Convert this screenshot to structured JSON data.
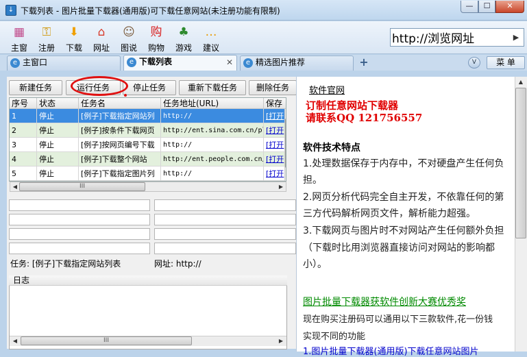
{
  "window": {
    "title": "下载列表 - 图片批量下载器(通用版)可下载任意网站(未注册功能有限制)",
    "min_glyph": "—",
    "max_glyph": "☐",
    "close_glyph": "✕"
  },
  "toolbar": {
    "items": [
      {
        "label": "主窗",
        "icon": "home-grid-icon",
        "glyph": "▦",
        "color": "#c04a8a"
      },
      {
        "label": "注册",
        "icon": "key-icon",
        "glyph": "⚿",
        "color": "#d2a023"
      },
      {
        "label": "下载",
        "icon": "download-arrow-icon",
        "glyph": "⬇",
        "color": "#f0a000"
      },
      {
        "label": "网址",
        "icon": "house-icon",
        "glyph": "⌂",
        "color": "#d83a2a"
      },
      {
        "label": "图说",
        "icon": "portrait-icon",
        "glyph": "☺",
        "color": "#7a5a3a"
      },
      {
        "label": "购物",
        "icon": "shopping-icon",
        "glyph": "购",
        "color": "#d81e1e"
      },
      {
        "label": "游戏",
        "icon": "game-icon",
        "glyph": "♣",
        "color": "#2e8a2e"
      },
      {
        "label": "建议",
        "icon": "chat-bubble-icon",
        "glyph": "…",
        "color": "#e89a00"
      }
    ]
  },
  "address": {
    "value": "http://浏览网址",
    "go_glyph": "▶"
  },
  "tabs": [
    {
      "label": "主窗口",
      "active": false
    },
    {
      "label": "下载列表",
      "active": true
    },
    {
      "label": "精选图片推荐",
      "active": false
    }
  ],
  "tab_add_glyph": "+",
  "tab_menu_glyph": "V",
  "menu_label": "菜 单",
  "actions": {
    "new": "新建任务",
    "run": "运行任务",
    "stop": "停止任务",
    "redownload": "重新下载任务",
    "delete": "删除任务"
  },
  "table": {
    "headers": [
      "序号",
      "状态",
      "任务名",
      "任务地址(URL)",
      "保存"
    ],
    "rows": [
      {
        "no": "1",
        "status": "停止",
        "name": "[例子]下载指定网站列",
        "url": "http://",
        "save": "[打开"
      },
      {
        "no": "2",
        "status": "停止",
        "name": "[例子]按条件下载网页",
        "url": "http://ent.sina.com.cn/pl",
        "save": "[打开"
      },
      {
        "no": "3",
        "status": "停止",
        "name": "[例子]按网页编号下载",
        "url": "http://",
        "save": "[打开"
      },
      {
        "no": "4",
        "status": "停止",
        "name": "[例子]下载整个网站",
        "url": "http://ent.people.com.cn/",
        "save": "[打开"
      },
      {
        "no": "5",
        "status": "停止",
        "name": "[例子]下载指定图片列",
        "url": "http://",
        "save": "[打开"
      }
    ]
  },
  "scroll": {
    "left": "◀",
    "right": "▶",
    "up": "▲",
    "down": "▼",
    "grip": "III"
  },
  "details": {
    "task_label": "任务: [例子]下载指定网站列表",
    "url_label": "网址: http://"
  },
  "log": {
    "title": "日志"
  },
  "info": {
    "official": "软件官网",
    "custom_line1": "订制任意网站下载器",
    "custom_line2": "请联系QQ 121756557",
    "features_title": "软件技术特点",
    "features": [
      "1.处理数据保存于内存中，不对硬盘产生任何负",
      "担。",
      "2.网页分析代码完全自主开发，不依靠任何的第",
      "三方代码解析网页文件，解析能力超强。",
      "3.下载网页与图片时不对网站产生任何额外负担",
      "（下载时比用浏览器直接访问对网站的影响都",
      "小）。"
    ],
    "award": "图片批量下载器获软件创新大赛优秀奖",
    "body": [
      "现在购买注册码可以通用以下三款软件,花一份钱",
      "实现不同的功能"
    ],
    "partial": "1.图片批量下载器(通用版)下载任意网站图片"
  }
}
